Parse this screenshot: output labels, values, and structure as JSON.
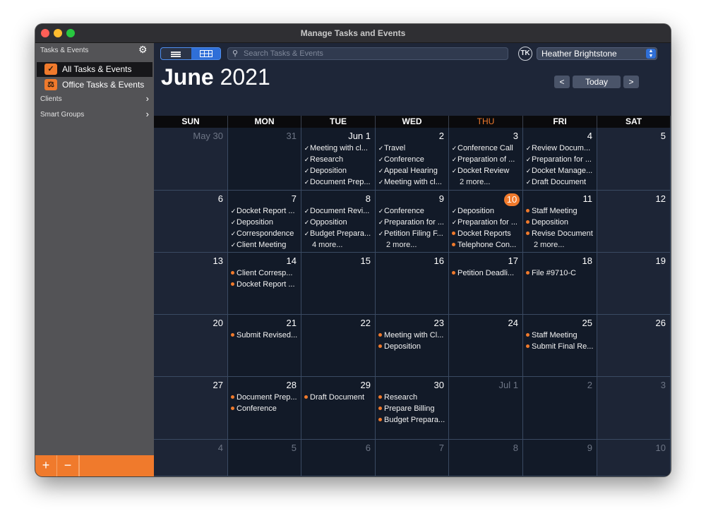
{
  "window": {
    "title": "Manage Tasks and Events"
  },
  "sidebar": {
    "header": "Tasks & Events",
    "items": [
      {
        "label": "All Tasks & Events",
        "icon": "checkbox-icon",
        "selected": true
      },
      {
        "label": "Office Tasks & Events",
        "icon": "scales-icon",
        "selected": false
      }
    ],
    "groups": [
      {
        "label": "Clients"
      },
      {
        "label": "Smart Groups"
      }
    ],
    "add_label": "+",
    "remove_label": "−"
  },
  "toolbar": {
    "search_placeholder": "Search Tasks & Events",
    "avatar_initials": "TK",
    "user_name": "Heather Brightstone",
    "prev_label": "<",
    "today_label": "Today",
    "next_label": ">"
  },
  "calendar": {
    "month": "June",
    "year": "2021",
    "weekdays": [
      "SUN",
      "MON",
      "TUE",
      "WED",
      "THU",
      "FRI",
      "SAT"
    ],
    "today_weekday_index": 4,
    "accent_color": "#f07a2c",
    "weeks": [
      [
        {
          "label": "May 30",
          "muted": true,
          "events": []
        },
        {
          "label": "31",
          "muted": true,
          "events": []
        },
        {
          "label": "Jun 1",
          "events": [
            {
              "text": "Meeting with cl...",
              "done": true
            },
            {
              "text": "Research",
              "done": true
            },
            {
              "text": "Deposition",
              "done": true
            },
            {
              "text": "Document Prep...",
              "done": true
            }
          ]
        },
        {
          "label": "2",
          "events": [
            {
              "text": "Travel",
              "done": true
            },
            {
              "text": "Conference",
              "done": true
            },
            {
              "text": "Appeal Hearing",
              "done": true
            },
            {
              "text": "Meeting with cl...",
              "done": true
            }
          ]
        },
        {
          "label": "3",
          "events": [
            {
              "text": "Conference Call",
              "done": true
            },
            {
              "text": "Preparation of ...",
              "done": true
            },
            {
              "text": "Docket Review",
              "done": true
            }
          ],
          "more": "2 more..."
        },
        {
          "label": "4",
          "events": [
            {
              "text": "Review Docum...",
              "done": true
            },
            {
              "text": "Preparation for ...",
              "done": true
            },
            {
              "text": "Docket Manage...",
              "done": true
            },
            {
              "text": "Draft Document",
              "done": true
            }
          ]
        },
        {
          "label": "5",
          "events": []
        }
      ],
      [
        {
          "label": "6",
          "events": []
        },
        {
          "label": "7",
          "events": [
            {
              "text": "Docket Report ...",
              "done": true
            },
            {
              "text": "Deposition",
              "done": true
            },
            {
              "text": "Correspondence",
              "done": true
            },
            {
              "text": "Client Meeting",
              "done": true
            }
          ]
        },
        {
          "label": "8",
          "events": [
            {
              "text": "Document Revi...",
              "done": true
            },
            {
              "text": "Opposition",
              "done": true
            },
            {
              "text": "Budget Prepara...",
              "done": true
            }
          ],
          "more": "4 more..."
        },
        {
          "label": "9",
          "events": [
            {
              "text": "Conference",
              "done": true
            },
            {
              "text": "Preparation for ...",
              "done": true
            },
            {
              "text": "Petition Filing F...",
              "done": true
            }
          ],
          "more": "2 more..."
        },
        {
          "label": "10",
          "today": true,
          "events": [
            {
              "text": "Deposition",
              "done": true
            },
            {
              "text": "Preparation for ...",
              "done": true
            },
            {
              "text": "Docket Reports",
              "done": false
            },
            {
              "text": "Telephone Con...",
              "done": false
            }
          ]
        },
        {
          "label": "11",
          "events": [
            {
              "text": "Staff Meeting",
              "done": false
            },
            {
              "text": "Deposition",
              "done": false
            },
            {
              "text": "Revise Document",
              "done": false
            }
          ],
          "more": "2 more..."
        },
        {
          "label": "12",
          "events": []
        }
      ],
      [
        {
          "label": "13",
          "events": []
        },
        {
          "label": "14",
          "events": [
            {
              "text": "Client Corresp...",
              "done": false
            },
            {
              "text": "Docket Report ...",
              "done": false
            }
          ]
        },
        {
          "label": "15",
          "events": []
        },
        {
          "label": "16",
          "events": []
        },
        {
          "label": "17",
          "events": [
            {
              "text": "Petition Deadli...",
              "done": false
            }
          ]
        },
        {
          "label": "18",
          "events": [
            {
              "text": "File #9710-C",
              "done": false
            }
          ]
        },
        {
          "label": "19",
          "events": []
        }
      ],
      [
        {
          "label": "20",
          "events": []
        },
        {
          "label": "21",
          "events": [
            {
              "text": "Submit Revised...",
              "done": false
            }
          ]
        },
        {
          "label": "22",
          "events": []
        },
        {
          "label": "23",
          "events": [
            {
              "text": "Meeting with Cl...",
              "done": false
            },
            {
              "text": "Deposition",
              "done": false
            }
          ]
        },
        {
          "label": "24",
          "events": []
        },
        {
          "label": "25",
          "events": [
            {
              "text": "Staff Meeting",
              "done": false
            },
            {
              "text": "Submit Final Re...",
              "done": false
            }
          ]
        },
        {
          "label": "26",
          "events": []
        }
      ],
      [
        {
          "label": "27",
          "events": []
        },
        {
          "label": "28",
          "events": [
            {
              "text": "Document Prep...",
              "done": false
            },
            {
              "text": "Conference",
              "done": false
            }
          ]
        },
        {
          "label": "29",
          "events": [
            {
              "text": "Draft Document",
              "done": false
            }
          ]
        },
        {
          "label": "30",
          "events": [
            {
              "text": "Research",
              "done": false
            },
            {
              "text": "Prepare Billing",
              "done": false
            },
            {
              "text": "Budget Prepara...",
              "done": false
            }
          ]
        },
        {
          "label": "Jul 1",
          "muted": true,
          "events": []
        },
        {
          "label": "2",
          "muted": true,
          "events": []
        },
        {
          "label": "3",
          "muted": true,
          "events": []
        }
      ],
      [
        {
          "label": "4",
          "muted": true,
          "events": []
        },
        {
          "label": "5",
          "muted": true,
          "events": []
        },
        {
          "label": "6",
          "muted": true,
          "events": []
        },
        {
          "label": "7",
          "muted": true,
          "events": []
        },
        {
          "label": "8",
          "muted": true,
          "events": []
        },
        {
          "label": "9",
          "muted": true,
          "events": []
        },
        {
          "label": "10",
          "muted": true,
          "events": []
        }
      ]
    ]
  }
}
